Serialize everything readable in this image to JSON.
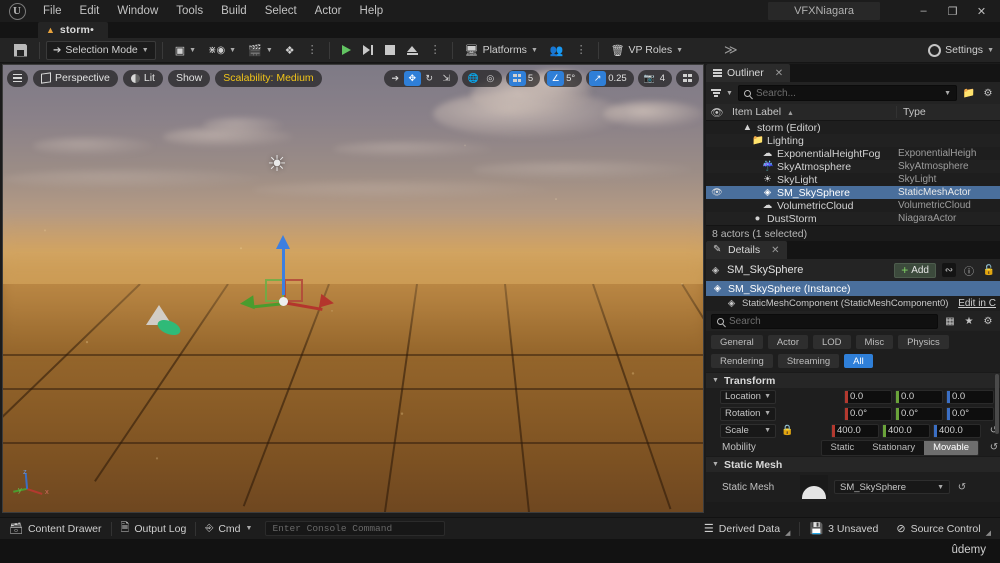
{
  "window": {
    "title": "VFXNiagara",
    "minimize": "–",
    "maximize": "❐",
    "close": "✕"
  },
  "menu": {
    "items": [
      "File",
      "Edit",
      "Window",
      "Tools",
      "Build",
      "Select",
      "Actor",
      "Help"
    ]
  },
  "tab": {
    "label": "storm•",
    "icon": "level-icon"
  },
  "toolbar": {
    "save_name": "save-icon",
    "selection_mode": "Selection Mode",
    "platforms": "Platforms",
    "vp_roles": "VP Roles",
    "settings": "Settings",
    "expand": "≫"
  },
  "viewport": {
    "menu_icon": "hamburger-icon",
    "camera": "Perspective",
    "lighting": "Lit",
    "show": "Show",
    "scalability": "Scalability: Medium",
    "grid_snap_value": "5",
    "angle_snap_value": "5°",
    "scale_snap_value": "0.25",
    "camera_speed_value": "4",
    "axis_x": "x",
    "axis_y": "y",
    "axis_z": "z"
  },
  "outliner": {
    "tab_label": "Outliner",
    "close": "✕",
    "search_placeholder": "Search...",
    "search_value": "",
    "columns": {
      "item_label": "Item Label",
      "sort_arrow": "▲",
      "type": "Type"
    },
    "rows": [
      {
        "label": "storm (Editor)",
        "type": "",
        "icon": "world-icon",
        "indent": 14,
        "selected": false,
        "eye": false
      },
      {
        "label": "Lighting",
        "type": "",
        "icon": "folder-icon",
        "indent": 24,
        "selected": false,
        "eye": false
      },
      {
        "label": "ExponentialHeightFog",
        "type": "ExponentialHeigh",
        "icon": "fog-icon",
        "indent": 34,
        "selected": false,
        "eye": false
      },
      {
        "label": "SkyAtmosphere",
        "type": "SkyAtmosphere",
        "icon": "atmosphere-icon",
        "indent": 34,
        "selected": false,
        "eye": false
      },
      {
        "label": "SkyLight",
        "type": "SkyLight",
        "icon": "skylight-icon",
        "indent": 34,
        "selected": false,
        "eye": false
      },
      {
        "label": "SM_SkySphere",
        "type": "StaticMeshActor",
        "icon": "mesh-icon",
        "indent": 34,
        "selected": true,
        "eye": true
      },
      {
        "label": "VolumetricCloud",
        "type": "VolumetricCloud",
        "icon": "cloud-icon",
        "indent": 34,
        "selected": false,
        "eye": false
      },
      {
        "label": "DustStorm",
        "type": "NiagaraActor",
        "icon": "niagara-icon",
        "indent": 24,
        "selected": false,
        "eye": false
      }
    ],
    "status": "8 actors (1 selected)"
  },
  "details": {
    "tab_label": "Details",
    "close": "✕",
    "object_name": "SM_SkySphere",
    "add_label": "Add",
    "tree": [
      {
        "label": "SM_SkySphere (Instance)",
        "selected": true,
        "indent": 6,
        "trailing": ""
      },
      {
        "label": "StaticMeshComponent (StaticMeshComponent0)",
        "selected": false,
        "indent": 20,
        "trailing": "Edit in C"
      }
    ],
    "search_placeholder": "Search",
    "search_value": "",
    "categories": [
      {
        "label": "General",
        "active": false
      },
      {
        "label": "Actor",
        "active": false
      },
      {
        "label": "LOD",
        "active": false
      },
      {
        "label": "Misc",
        "active": false
      },
      {
        "label": "Physics",
        "active": false
      },
      {
        "label": "Rendering",
        "active": false
      },
      {
        "label": "Streaming",
        "active": false
      },
      {
        "label": "All",
        "active": true
      }
    ],
    "transform": {
      "section": "Transform",
      "location": {
        "label": "Location",
        "x": "0.0",
        "y": "0.0",
        "z": "0.0"
      },
      "rotation": {
        "label": "Rotation",
        "x": "0.0°",
        "y": "0.0°",
        "z": "0.0°"
      },
      "scale": {
        "label": "Scale",
        "x": "400.0",
        "y": "400.0",
        "z": "400.0"
      },
      "mobility": {
        "label": "Mobility",
        "options": [
          "Static",
          "Stationary",
          "Movable"
        ],
        "selected": "Movable"
      }
    },
    "static_mesh": {
      "section": "Static Mesh",
      "prop_label": "Static Mesh",
      "value": "SM_SkySphere"
    }
  },
  "statusbar": {
    "content_drawer": "Content Drawer",
    "output_log": "Output Log",
    "cmd": "Cmd",
    "console_placeholder": "Enter Console Command",
    "derived_data": "Derived Data",
    "unsaved": "3 Unsaved",
    "source_control": "Source Control"
  },
  "watermark": {
    "text": "ûdemy"
  },
  "colors": {
    "accent_blue": "#2f7fd8",
    "selection_blue": "#4a6f9c",
    "scalability_yellow": "#f0c419",
    "axis_x_red": "#b3392f",
    "axis_y_green": "#6aa33a",
    "axis_z_blue": "#3b6fc4",
    "play_green": "#62c462"
  }
}
